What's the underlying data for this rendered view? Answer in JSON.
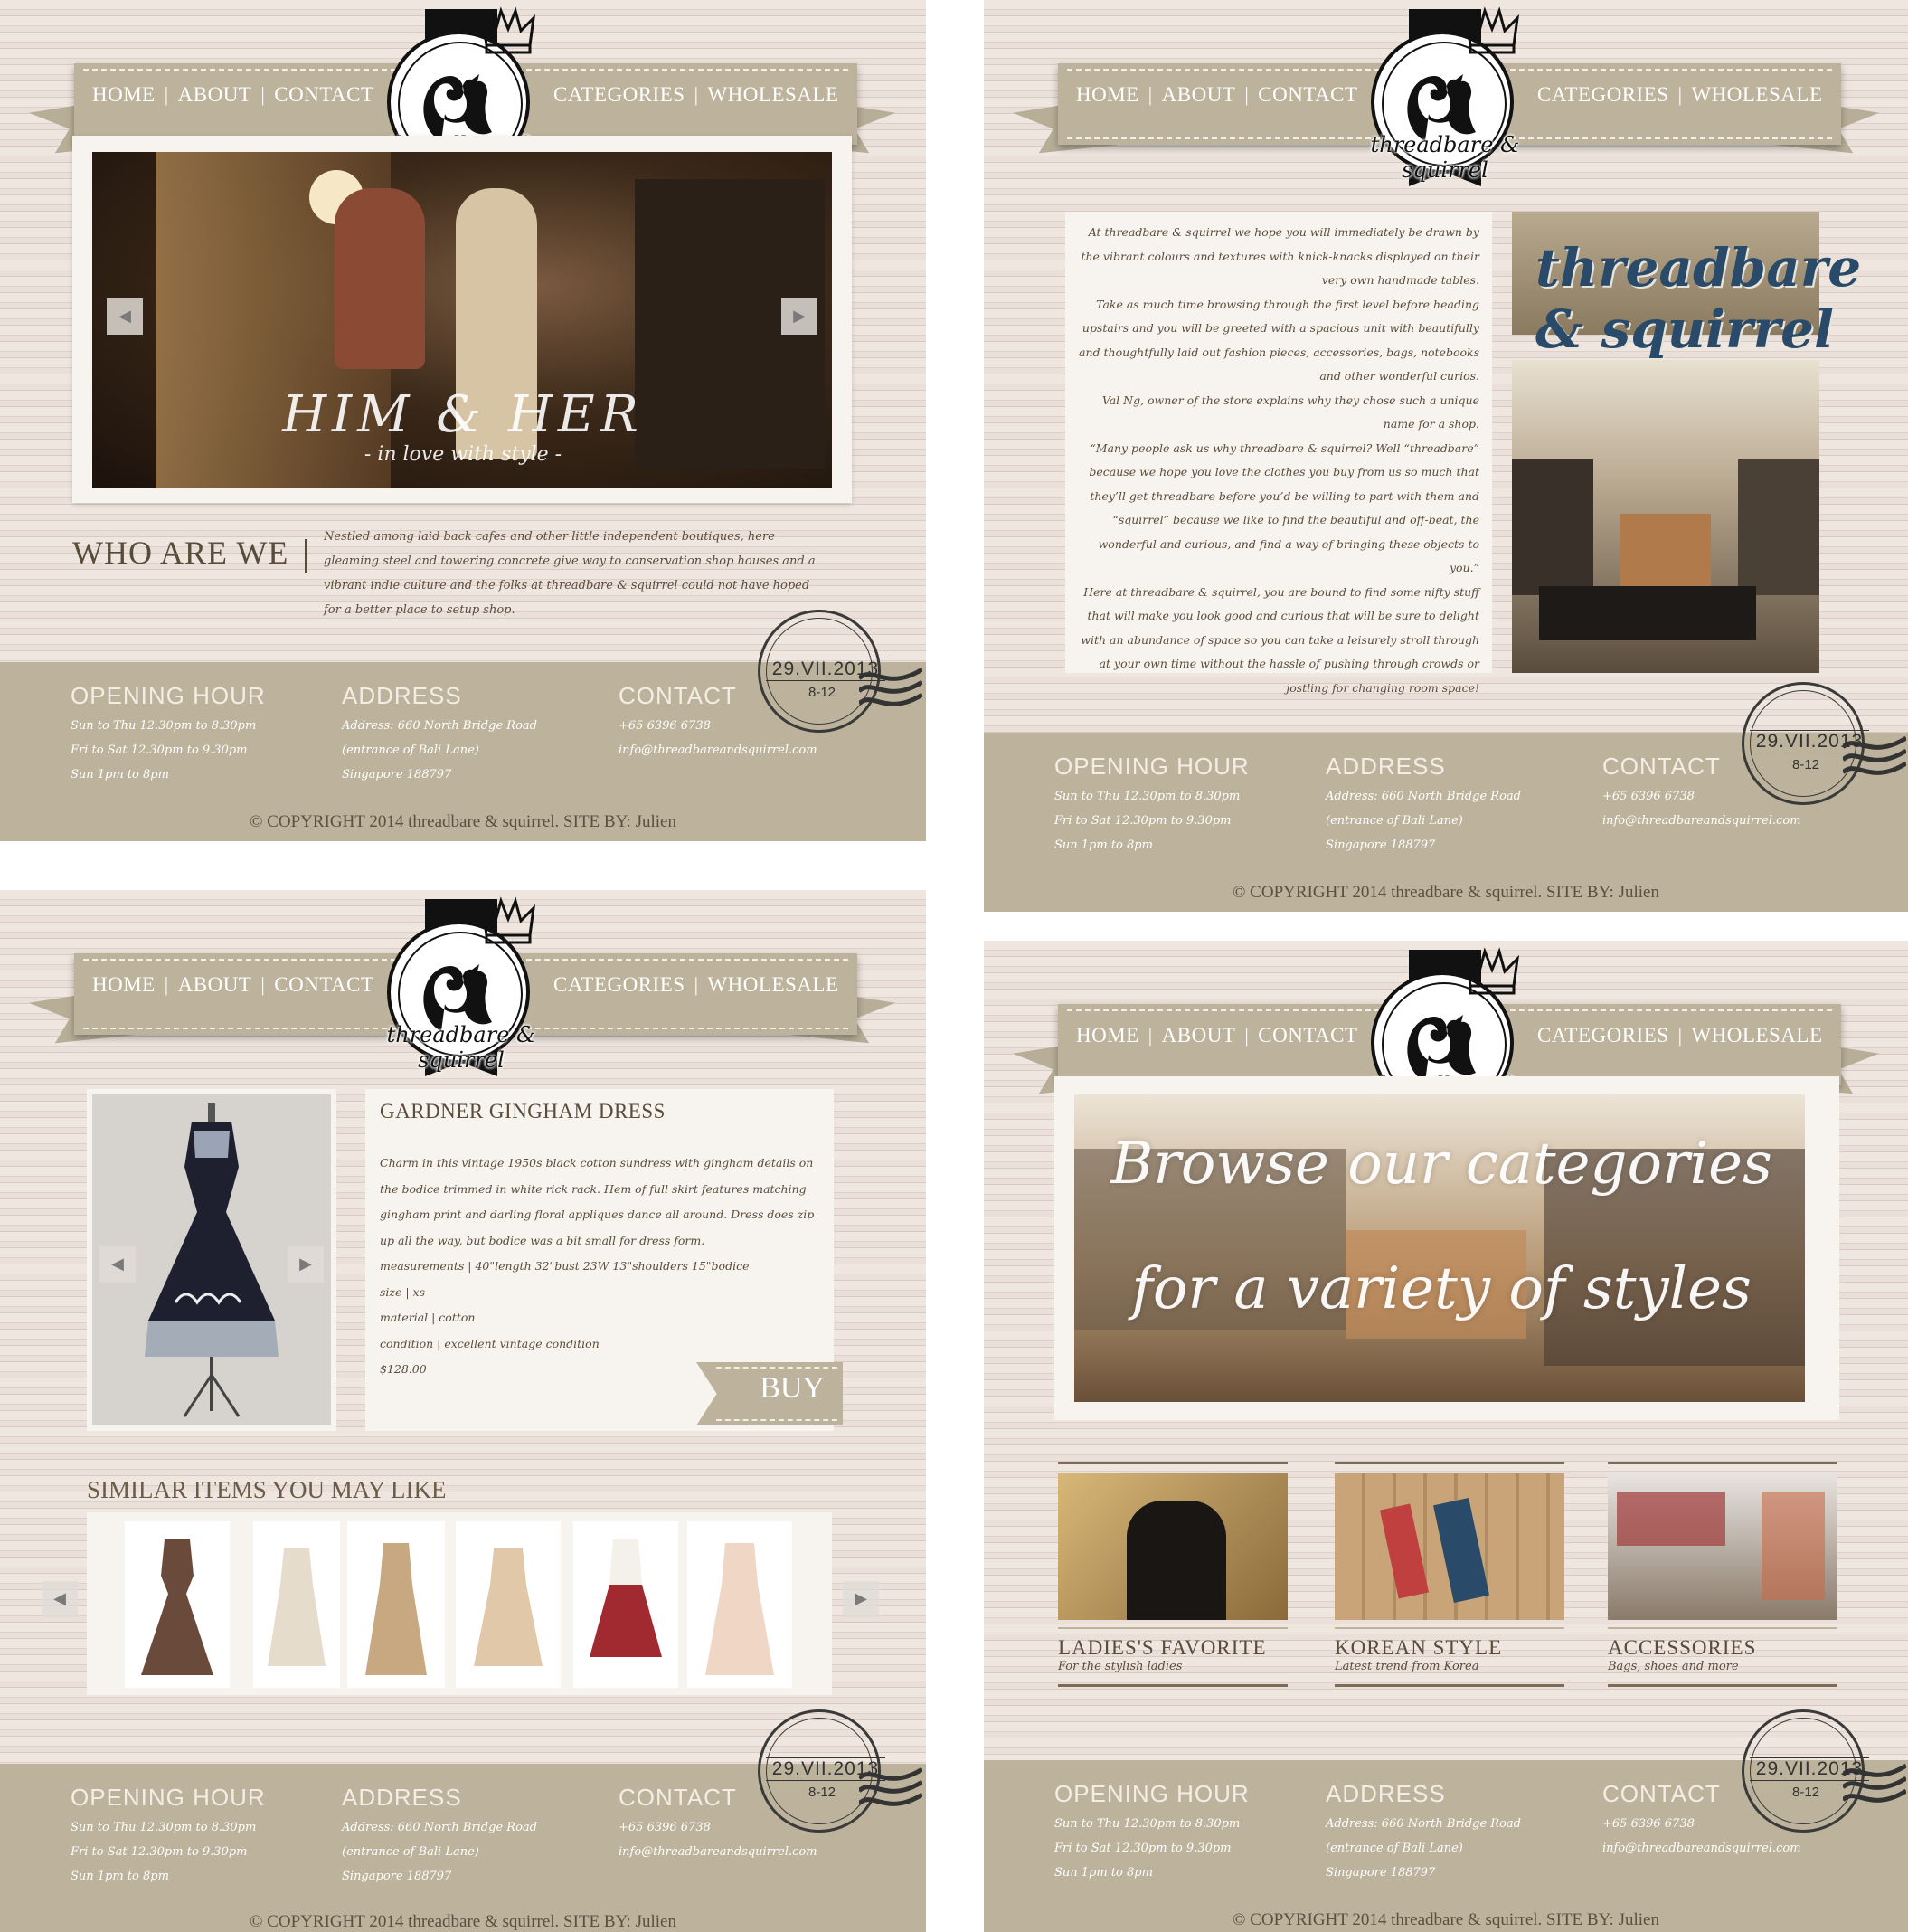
{
  "brand": {
    "name": "threadbare & squirrel"
  },
  "nav": {
    "home": "HOME",
    "about": "ABOUT",
    "contact": "CONTACT",
    "categories": "CATEGORIES",
    "wholesale": "WHOLESALE",
    "sep": "|"
  },
  "footer": {
    "opening_title": "OPENING HOUR",
    "opening_lines": [
      "Sun to Thu 12.30pm to 8.30pm",
      "Fri to Sat 12.30pm to 9.30pm",
      "Sun 1pm to 8pm"
    ],
    "address_title": "ADDRESS",
    "address_lines": [
      "Address: 660 North Bridge Road",
      "(entrance of Bali Lane)",
      "Singapore 188797"
    ],
    "contact_title": "CONTACT",
    "contact_lines": [
      "+65 6396 6738",
      "info@threadbareandsquirrel.com"
    ],
    "copyright": "© COPYRIGHT 2014 threadbare & squirrel. SITE BY: Julien",
    "stamp_date": "29.VII.2013",
    "stamp_time": "8-12"
  },
  "home": {
    "hero_title": "HIM & HER",
    "hero_subtitle": "- in love with style -",
    "who_title": "WHO ARE WE",
    "who_text": "Nestled among laid back cafes and other little independent boutiques, here gleaming steel and towering concrete give way to conservation shop houses and a vibrant indie culture and the folks at threadbare & squirrel could not have hoped for a better place to setup shop."
  },
  "about": {
    "paragraphs": [
      "At threadbare & squirrel we hope you will immediately be drawn by the vibrant colours and textures with knick-knacks displayed on their very own handmade tables.",
      "Take as much time browsing through the first level before heading upstairs and you will be greeted with a spacious unit with beautifully and thoughtfully laid out fashion pieces, accessories, bags, notebooks and other wonderful curios.",
      "Val Ng, owner of the store explains why they chose such a unique name for a shop.",
      "“Many people ask us why threadbare & squirrel? Well “threadbare” because we hope you love the clothes you buy from us so much that they’ll get threadbare before you’d be willing to part with them and “squirrel” because we like to find the beautiful and off-beat, the wonderful and curious, and find a way of bringing these objects to you.”",
      "Here at threadbare & squirrel, you are bound to find some nifty stuff that will make you look good and curious that will be sure to delight with an abundance of space so you can take a leisurely stroll through at your own time without the hassle of pushing through crowds or jostling for changing room space!"
    ],
    "sign_text": "threadbare & squirrel"
  },
  "product": {
    "title": "GARDNER GINGHAM DRESS",
    "description": "Charm in this vintage 1950s black cotton sundress with gingham details on the bodice trimmed in white rick rack. Hem of full skirt features matching gingham print and darling floral appliques dance all around. Dress does zip up all the way, but bodice was a bit small for dress form.",
    "measurements": "measurements | 40\"length 32\"bust 23W 13\"shoulders 15\"bodice",
    "size": "size | xs",
    "material": "material | cotton",
    "condition": "condition | excellent vintage condition",
    "price": "$128.00",
    "buy": "BUY",
    "similar_title": "SIMILAR ITEMS YOU MAY LIKE"
  },
  "categories": {
    "hero_line1": "Browse our categories",
    "hero_line2": "for a variety of styles",
    "items": [
      {
        "title": "LADIES'S FAVORITE",
        "subtitle": "For the stylish ladies"
      },
      {
        "title": "KOREAN STYLE",
        "subtitle": "Latest trend from Korea"
      },
      {
        "title": "ACCESSORIES",
        "subtitle": "Bags, shoes and more"
      }
    ]
  },
  "arrows": {
    "left": "◀",
    "right": "▶"
  },
  "colors": {
    "ribbon": "#bdb39c",
    "text": "#5a4c3a",
    "paper": "#f7f3ee"
  }
}
